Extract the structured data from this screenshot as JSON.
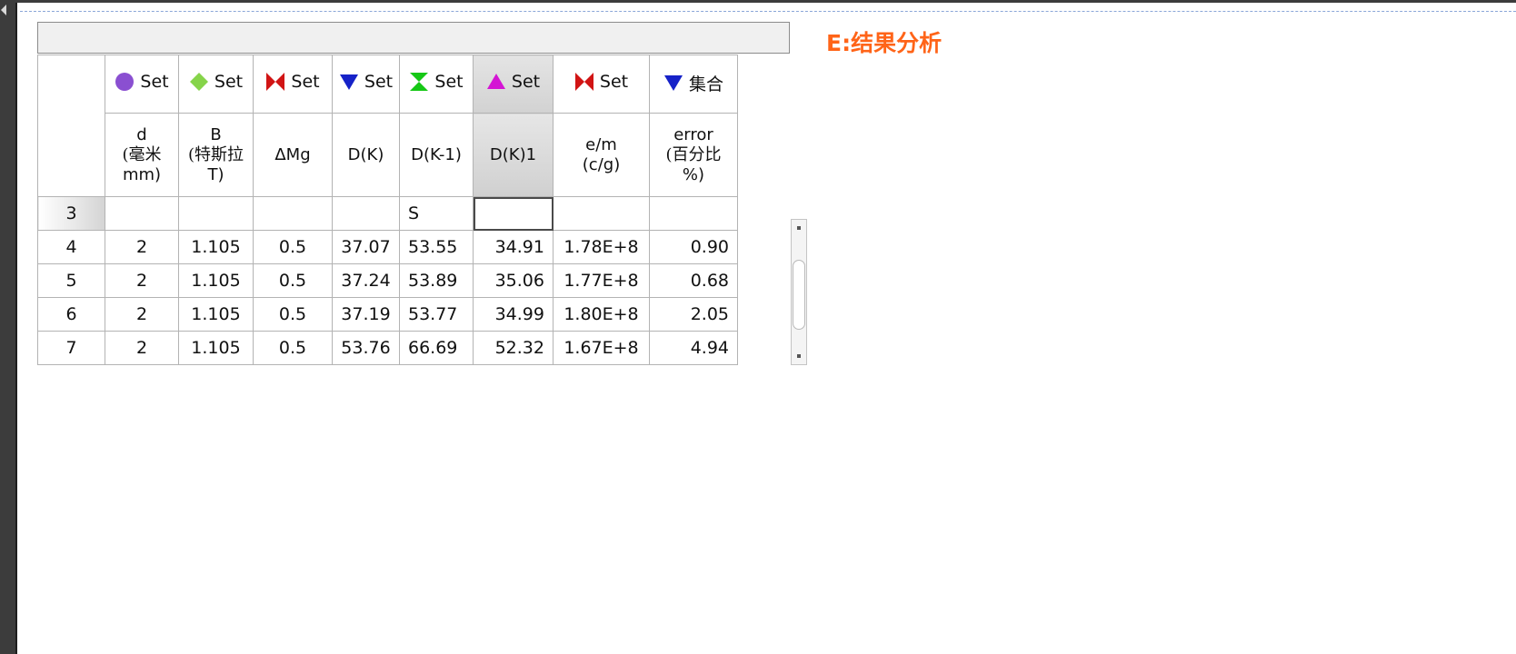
{
  "page": {
    "section_title": "E:结果分析"
  },
  "table": {
    "column_sets": [
      {
        "label": "Set",
        "marker": "circle-icon",
        "color": "#8a4fd1"
      },
      {
        "label": "Set",
        "marker": "diamond-icon",
        "color": "#86d44a"
      },
      {
        "label": "Set",
        "marker": "bowtie-icon",
        "color": "#d11414"
      },
      {
        "label": "Set",
        "marker": "triangle-down-icon",
        "color": "#1622c8"
      },
      {
        "label": "Set",
        "marker": "hourglass-icon",
        "color": "#16c816"
      },
      {
        "label": "Set",
        "marker": "triangle-up-icon",
        "color": "#d414d4"
      },
      {
        "label": "Set",
        "marker": "bowtie-icon",
        "color": "#d11414"
      },
      {
        "label": "集合",
        "marker": "triangle-down-icon",
        "color": "#1622c8"
      }
    ],
    "column_labels": [
      [
        "d",
        "(毫米",
        "mm)"
      ],
      [
        "B",
        "(特斯拉",
        "T)"
      ],
      [
        "ΔMg"
      ],
      [
        "D(K)"
      ],
      [
        "D(K-1)"
      ],
      [
        "D(K)1"
      ],
      [
        "e/m",
        "(c/g)"
      ],
      [
        "error",
        "(百分比",
        "%)"
      ]
    ],
    "rows": [
      {
        "num": "3",
        "cells": [
          "",
          "",
          "",
          "",
          "S",
          "",
          "",
          ""
        ]
      },
      {
        "num": "4",
        "cells": [
          "2",
          "1.105",
          "0.5",
          "37.07",
          "53.55",
          "34.91",
          "1.78E+8",
          "0.90"
        ]
      },
      {
        "num": "5",
        "cells": [
          "2",
          "1.105",
          "0.5",
          "37.24",
          "53.89",
          "35.06",
          "1.77E+8",
          "0.68"
        ]
      },
      {
        "num": "6",
        "cells": [
          "2",
          "1.105",
          "0.5",
          "37.19",
          "53.77",
          "34.99",
          "1.80E+8",
          "2.05"
        ]
      },
      {
        "num": "7",
        "cells": [
          "2",
          "1.105",
          "0.5",
          "53.76",
          "66.69",
          "52.32",
          "1.67E+8",
          "4.94"
        ]
      }
    ]
  }
}
